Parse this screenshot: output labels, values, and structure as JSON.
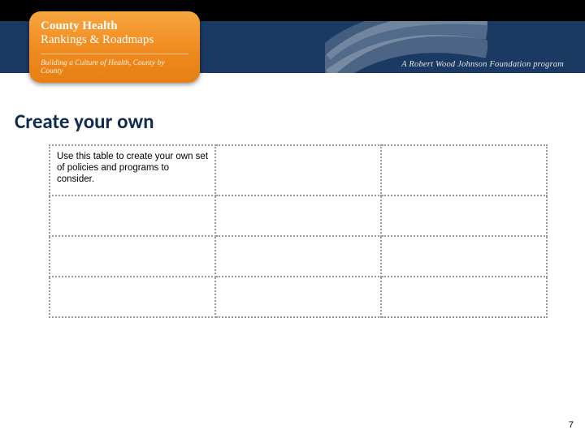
{
  "header": {
    "badge_line1": "County Health",
    "badge_line2": "Rankings & Roadmaps",
    "badge_sub": "Building a Culture of Health, County by County",
    "tagline": "A Robert Wood Johnson Foundation program"
  },
  "title": "Create your own",
  "table": {
    "instruction": "Use this table to create your own set of policies and programs to consider.",
    "rows": 4,
    "cols": 3
  },
  "page_number": "7"
}
